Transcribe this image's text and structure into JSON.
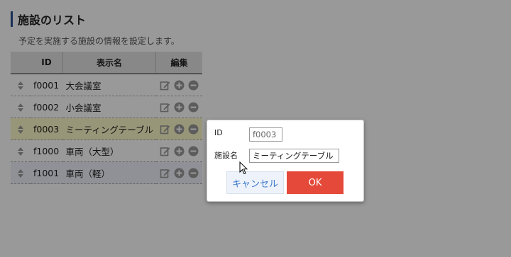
{
  "header": {
    "title": "施設のリスト",
    "subtitle": "予定を実施する施設の情報を設定します。"
  },
  "table": {
    "columns": [
      "",
      "ID",
      "表示名",
      "編集"
    ],
    "rows": [
      {
        "id": "f0001",
        "name": "大会議室"
      },
      {
        "id": "f0002",
        "name": "小会議室"
      },
      {
        "id": "f0003",
        "name": "ミーティングテーブル"
      },
      {
        "id": "f1000",
        "name": "車両（大型）"
      },
      {
        "id": "f1001",
        "name": "車両（軽）"
      }
    ],
    "highlighted_row_index": 2
  },
  "dialog": {
    "id_label": "ID",
    "id_value": "f0003",
    "name_label": "施設名",
    "name_value": "ミーティングテーブル",
    "cancel_label": "キャンセル",
    "ok_label": "OK"
  },
  "icons": {
    "sort": "sort-icon",
    "edit": "edit-icon",
    "add": "plus-circle-icon",
    "remove": "minus-circle-icon"
  },
  "colors": {
    "accent_bar": "#2b4f8f",
    "ok_button": "#e5493a",
    "cancel_text": "#3a78c9",
    "row_highlight": "#fdfbc8",
    "row_alt": "#eef2fa",
    "icon_gray": "#9a9a9a"
  }
}
